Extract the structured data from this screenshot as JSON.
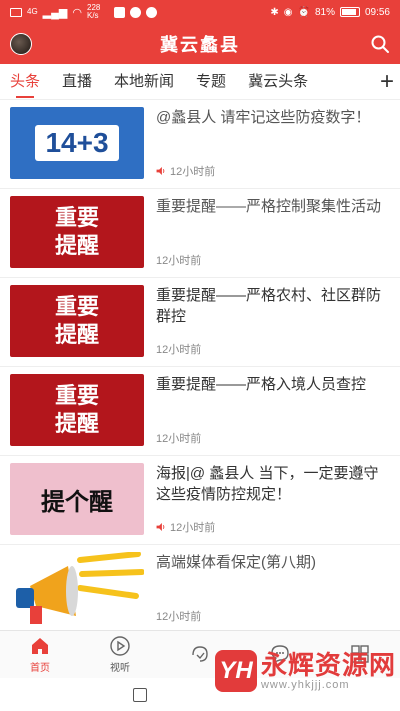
{
  "status_bar": {
    "left_texts": [
      "HD",
      "4G",
      "228 K/s"
    ],
    "battery": "81%",
    "time": "09:56"
  },
  "header": {
    "title": "冀云蠡县"
  },
  "tabs": [
    {
      "label": "头条",
      "active": true
    },
    {
      "label": "直播"
    },
    {
      "label": "本地新闻"
    },
    {
      "label": "专题"
    },
    {
      "label": "冀云头条"
    }
  ],
  "add_tab_label": "+",
  "news": [
    {
      "thumb_text": "14+3",
      "title": "@蠡县人 请牢记这些防疫数字！",
      "time": "12小时前",
      "audio": true
    },
    {
      "thumb_lines": [
        "重要",
        "提醒"
      ],
      "title": "重要提醒——严格控制聚集性活动",
      "time": "12小时前",
      "audio": false
    },
    {
      "thumb_lines": [
        "重要",
        "提醒"
      ],
      "title": "重要提醒——严格农村、社区群防群控",
      "time": "12小时前",
      "audio": false
    },
    {
      "thumb_lines": [
        "重要",
        "提醒"
      ],
      "title": "重要提醒——严格入境人员查控",
      "time": "12小时前",
      "audio": false
    },
    {
      "thumb_text": "提个醒",
      "title": "海报|@ 蠡县人 当下，一定要遵守这些疫情防控规定！",
      "time": "12小时前",
      "audio": true
    },
    {
      "title": "高端媒体看保定(第八期)",
      "time": "12小时前",
      "audio": false
    }
  ],
  "bottom_nav": [
    {
      "label": "首页",
      "icon": "home-icon",
      "active": true
    },
    {
      "label": "视听",
      "icon": "play-icon"
    },
    {
      "label": "",
      "icon": "hand-icon"
    },
    {
      "label": "",
      "icon": "chat-icon"
    },
    {
      "label": "",
      "icon": "grid-icon"
    }
  ],
  "watermark": {
    "logo": "YH",
    "main": "永辉资源网",
    "url": "www.yhkjjj.com"
  },
  "colors": {
    "brand_red": "#e8403a",
    "thumb_red": "#b3161c"
  }
}
